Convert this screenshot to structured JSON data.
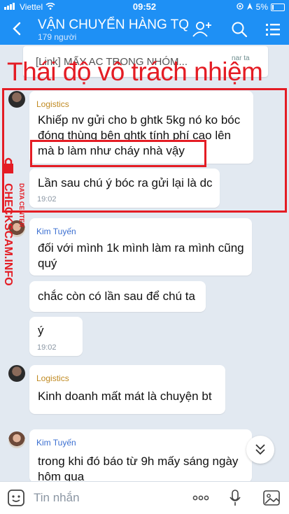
{
  "status": {
    "carrier": "Viettel",
    "time": "09:52",
    "battery": "5%"
  },
  "header": {
    "title": "VẬN CHUYỂN HÀNG TQ",
    "subtitle": "179 người"
  },
  "pinned": {
    "text": "[Link] MẤY AC TRONG NHÓM...",
    "tag": "nar\nta"
  },
  "overlay": {
    "title": "Thái độ vô trách nhiệm",
    "watermark_top": "DATA CENTER",
    "watermark_main": "CHECKSCAM.INFO"
  },
  "messages": [
    {
      "sender": "Logistics",
      "lines": [
        "Khiếp nv gửi cho b ghtk 5kg nó ko bóc",
        "đóng thùng bên ghtk tính phí cao lên",
        "mà b làm như cháy nhà vậy"
      ]
    },
    {
      "lines": [
        "Lần sau chú ý bóc ra gửi lại là dc"
      ],
      "time": "19:02"
    },
    {
      "sender": "Kim Tuyến",
      "lines": [
        "đối với mình 1k mình làm ra mình cũng",
        "quý"
      ]
    },
    {
      "lines": [
        "chắc còn có lần sau để chú ta"
      ]
    },
    {
      "lines": [
        "ý"
      ],
      "time": "19:02"
    },
    {
      "sender": "Logistics",
      "lines": [
        "Kinh doanh mất mát là chuyện bt"
      ]
    },
    {
      "sender": "Kim Tuyến",
      "lines": [
        "trong khi đó báo từ 9h mấy sáng ngày",
        "hôm qua"
      ]
    }
  ],
  "input": {
    "placeholder": "Tin nhắn"
  },
  "colors": {
    "primary": "#1e90f5",
    "logistics_name": "#c08a21",
    "kim_name": "#3b6fd1",
    "alert": "#e41c24"
  }
}
